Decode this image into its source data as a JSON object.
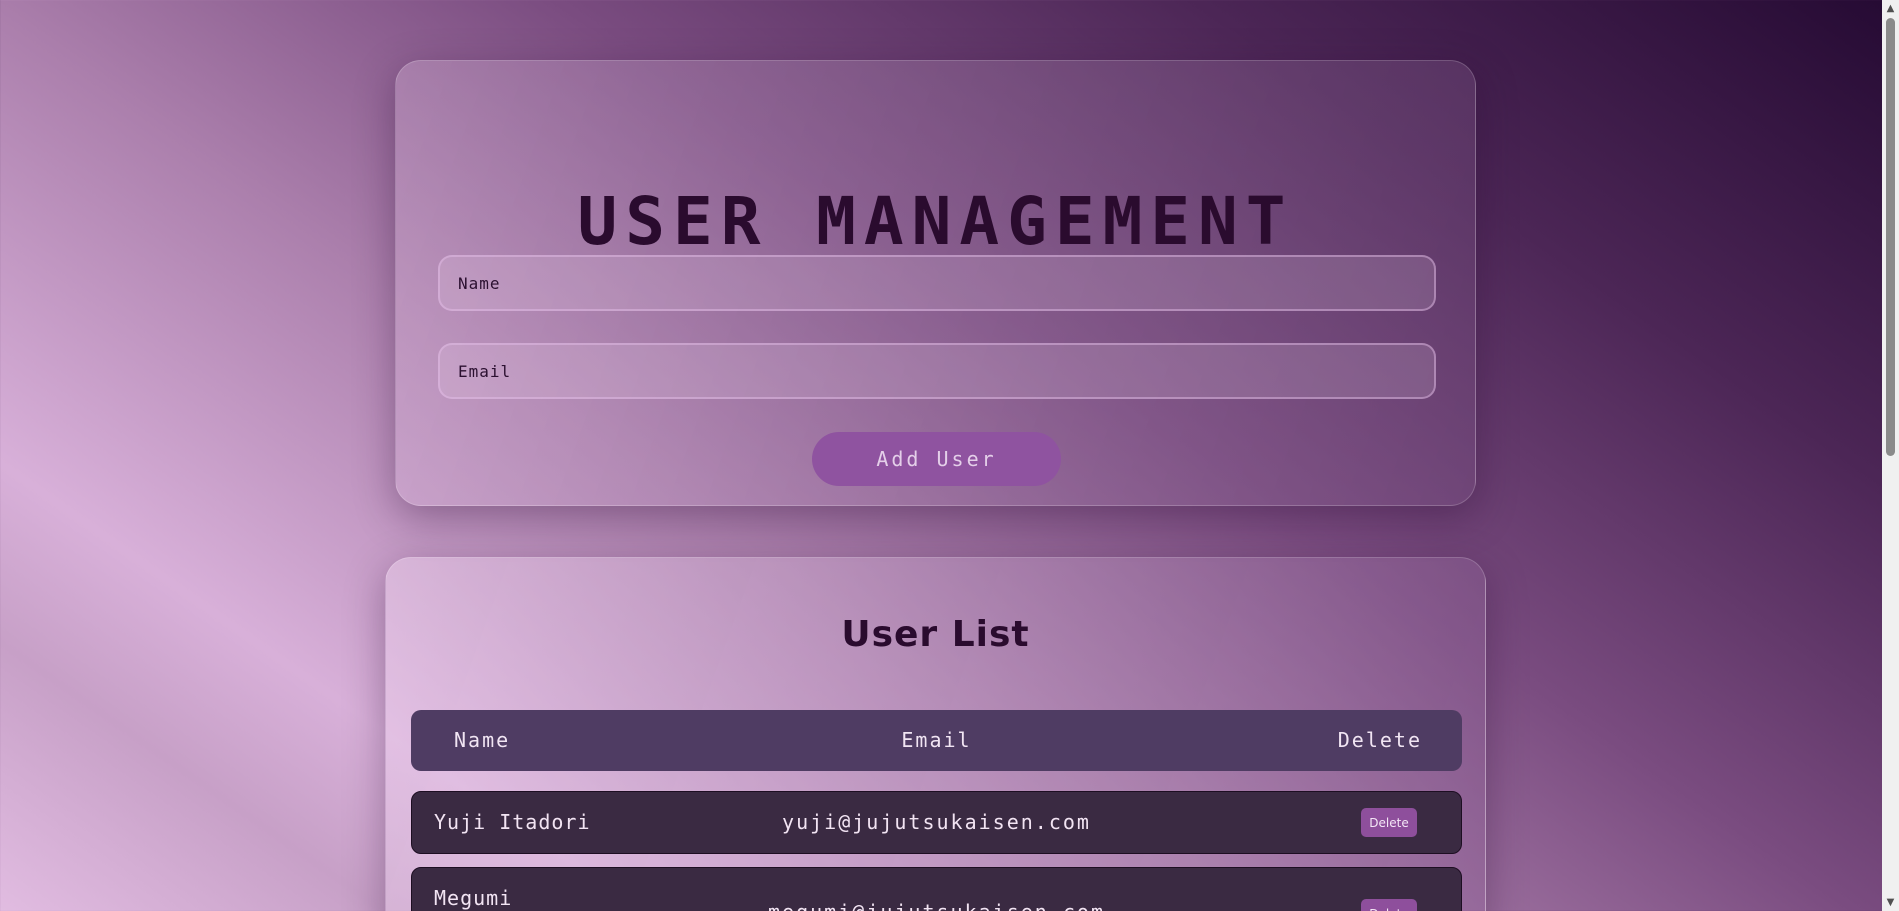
{
  "form": {
    "title": "USER MANAGEMENT",
    "name_placeholder": "Name",
    "email_placeholder": "Email",
    "add_button": "Add User"
  },
  "list": {
    "title": "User List",
    "columns": [
      "Name",
      "Email",
      "Delete"
    ],
    "rows": [
      {
        "name": "Yuji Itadori",
        "email": "yuji@jujutsukaisen.com",
        "action": "Delete"
      },
      {
        "name": "Megumi",
        "email": "megumi@jujutsukaisen.com",
        "action": "Delete"
      }
    ]
  },
  "colors": {
    "accent": "#8f53a0",
    "header_bg": "#4f3c63",
    "row_bg": "#3a2a42",
    "title_text": "#2a0b2e"
  },
  "icons": {
    "scroll_up": "scroll-up-icon",
    "scroll_down": "scroll-down-icon"
  }
}
